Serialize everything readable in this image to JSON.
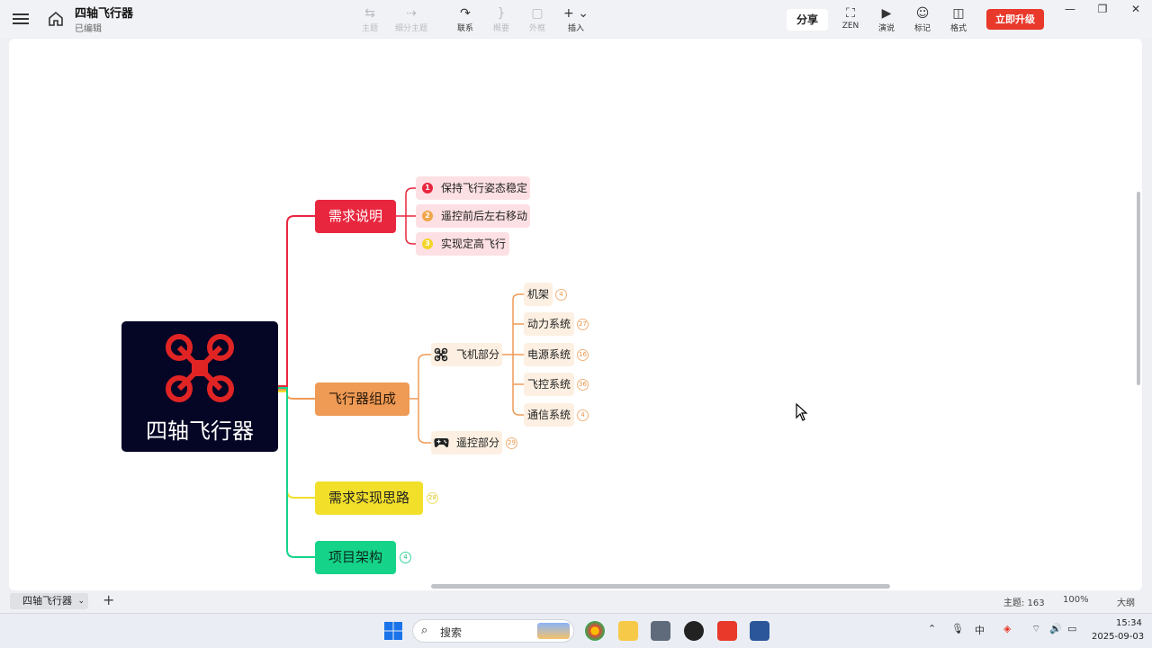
{
  "app": {
    "title": "四轴飞行器",
    "status": "已编辑"
  },
  "toolbar": {
    "tools": [
      {
        "id": "topic",
        "label": "主题",
        "icon": "topic-icon",
        "enabled": false
      },
      {
        "id": "subtopic",
        "label": "细分主题",
        "icon": "subtopic-icon",
        "enabled": false
      },
      {
        "id": "relation",
        "label": "联系",
        "icon": "relation-icon",
        "enabled": true
      },
      {
        "id": "summary",
        "label": "概要",
        "icon": "summary-icon",
        "enabled": false
      },
      {
        "id": "boundary",
        "label": "外框",
        "icon": "boundary-icon",
        "enabled": false
      },
      {
        "id": "insert",
        "label": "插入",
        "icon": "plus-icon",
        "enabled": true
      }
    ],
    "share_label": "分享",
    "right_tools": [
      {
        "id": "zen",
        "label": "ZEN",
        "icon": "fullscreen-icon"
      },
      {
        "id": "present",
        "label": "演说",
        "icon": "play-icon"
      },
      {
        "id": "marker",
        "label": "标记",
        "icon": "smiley-icon"
      },
      {
        "id": "format",
        "label": "格式",
        "icon": "panel-icon"
      }
    ],
    "upgrade_label": "立即升级"
  },
  "mindmap": {
    "root": {
      "label": "四轴飞行器",
      "icon": "quadcopter-icon"
    },
    "branches": [
      {
        "label": "需求说明",
        "color": "#e8273f"
      },
      {
        "label": "飞行器组成",
        "color": "#ef9a55"
      },
      {
        "label": "需求实现思路",
        "color": "#f1df2a",
        "count": "28"
      },
      {
        "label": "项目架构",
        "color": "#16d38a",
        "count": "4"
      }
    ],
    "requirements": [
      {
        "num": "1",
        "label": "保持飞行姿态稳定",
        "color": "#e8273f"
      },
      {
        "num": "2",
        "label": "遥控前后左右移动",
        "color": "#f0a54a"
      },
      {
        "num": "3",
        "label": "实现定高飞行",
        "color": "#f2d52b"
      }
    ],
    "parts": [
      {
        "label": "飞机部分",
        "icon": "drone-icon"
      },
      {
        "label": "遥控部分",
        "icon": "gamepad-icon",
        "count": "29"
      }
    ],
    "systems": [
      {
        "label": "机架",
        "count": "4"
      },
      {
        "label": "动力系统",
        "count": "27"
      },
      {
        "label": "电源系统",
        "count": "16"
      },
      {
        "label": "飞控系统",
        "count": "36"
      },
      {
        "label": "通信系统",
        "count": "4"
      }
    ]
  },
  "sheet": {
    "tab_label": "四轴飞行器",
    "topic_count": "主题: 163",
    "zoom": "100%",
    "outline_label": "大纲"
  },
  "taskbar": {
    "search_placeholder": "搜索",
    "time": "15:34",
    "date": "2025-09-03"
  }
}
